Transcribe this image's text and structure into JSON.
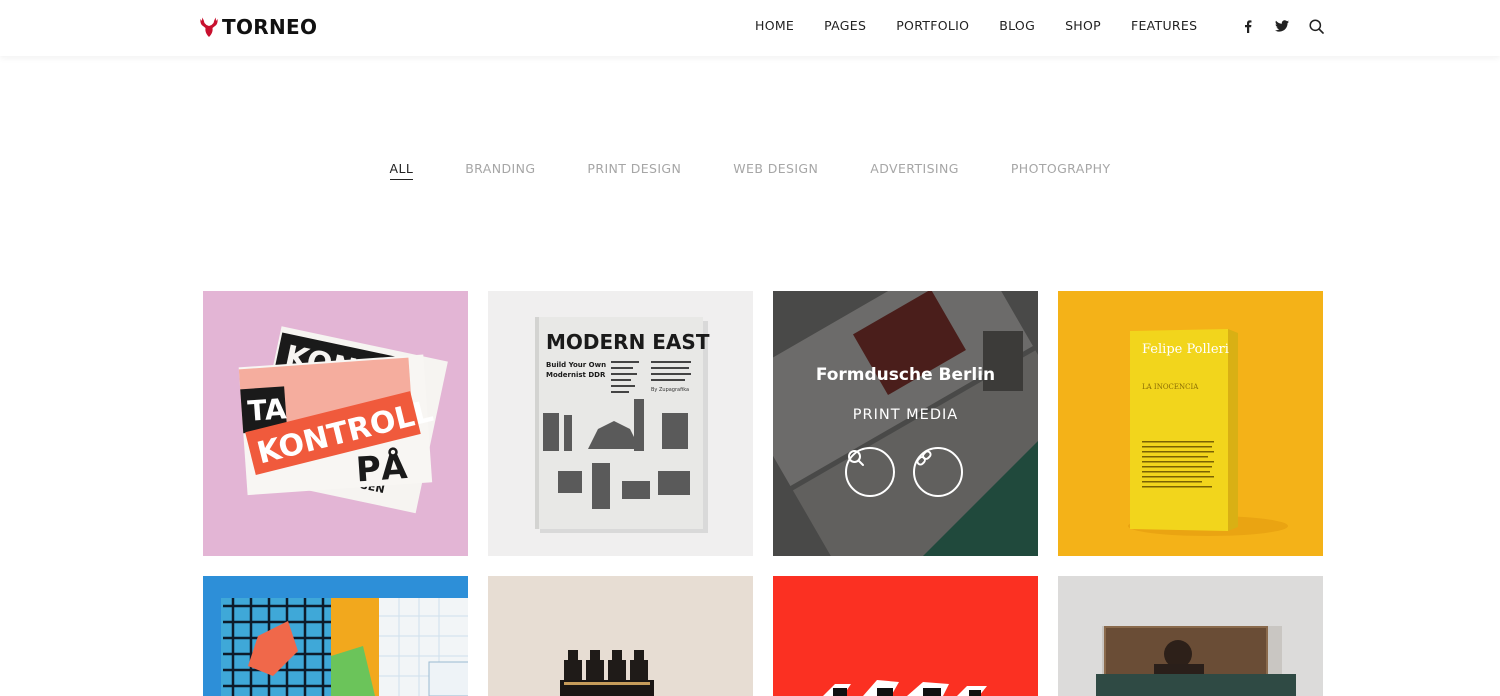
{
  "brand": {
    "name": "TORNEO",
    "accent": "#c8102e"
  },
  "nav": {
    "items": [
      "HOME",
      "PAGES",
      "PORTFOLIO",
      "BLOG",
      "SHOP",
      "FEATURES"
    ],
    "icons": [
      "facebook-icon",
      "twitter-icon",
      "search-icon"
    ]
  },
  "filters": {
    "items": [
      "ALL",
      "BRANDING",
      "PRINT DESIGN",
      "WEB DESIGN",
      "ADVERTISING",
      "PHOTOGRAPHY"
    ],
    "active": "ALL"
  },
  "portfolio": {
    "items": [
      {
        "art": {
          "label1": "TA",
          "label2": "KONTROLL",
          "label3": "PÅ",
          "label4": "KON",
          "label5": "SEN"
        }
      },
      {
        "art": {
          "title": "MODERN EAST",
          "subtitle1": "Build Your Own",
          "subtitle2": "Modernist DDR",
          "credit": "By Zupagrafika"
        }
      },
      {
        "hover": {
          "title": "Formdusche Berlin",
          "category": "PRINT MEDIA"
        }
      },
      {
        "art": {
          "author": "Felipe Polleri",
          "book_title": "LA INOCENCIA"
        }
      },
      {},
      {},
      {},
      {}
    ]
  },
  "colors": {
    "text": "#222222",
    "muted": "#a6a6a6"
  }
}
